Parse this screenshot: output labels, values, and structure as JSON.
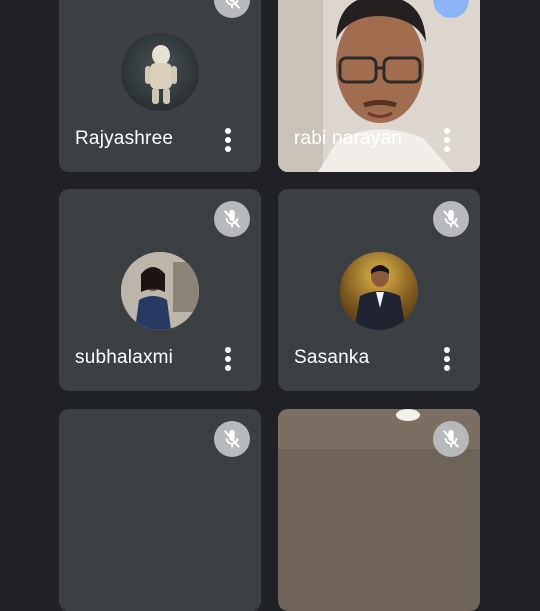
{
  "participants": [
    {
      "name": "Rajyashree",
      "muted": true,
      "view": "avatar"
    },
    {
      "name": "rabi narayan",
      "muted": false,
      "view": "video",
      "badge_color": "#8ab4f8"
    },
    {
      "name": "subhalaxmi",
      "muted": true,
      "view": "avatar"
    },
    {
      "name": "Sasanka",
      "muted": true,
      "view": "avatar"
    },
    {
      "name": "",
      "muted": true,
      "view": "avatar"
    },
    {
      "name": "",
      "muted": true,
      "view": "video"
    }
  ],
  "icons": {
    "mic_off": "mic-off-icon",
    "more": "more-vert-icon"
  },
  "colors": {
    "background": "#202124",
    "tile": "#3c4043",
    "mute_badge": "#b8b9bc",
    "text": "#ffffff"
  }
}
